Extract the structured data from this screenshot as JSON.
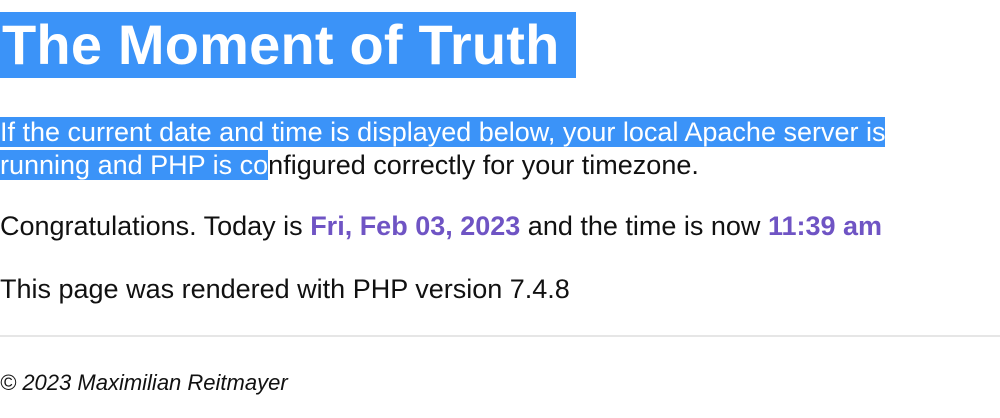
{
  "page": {
    "title": "The Moment of Truth",
    "intro_selected_part1": "If the current date and time is displayed below, your local Apache server is",
    "intro_selected_part2": "running and PHP is co",
    "intro_rest": "nfigured correctly for your timezone.",
    "congrats_prefix": "Congratulations. Today is ",
    "date": "Fri, Feb 03, 2023",
    "congrats_middle": " and the time is now ",
    "time": "11:39 am",
    "version_text": "This page was rendered with PHP version 7.4.8",
    "footer_text": "© 2023 Maximilian Reitmayer"
  },
  "colors": {
    "selection_highlight": "#3b93f8",
    "accent": "#6f54c4"
  }
}
